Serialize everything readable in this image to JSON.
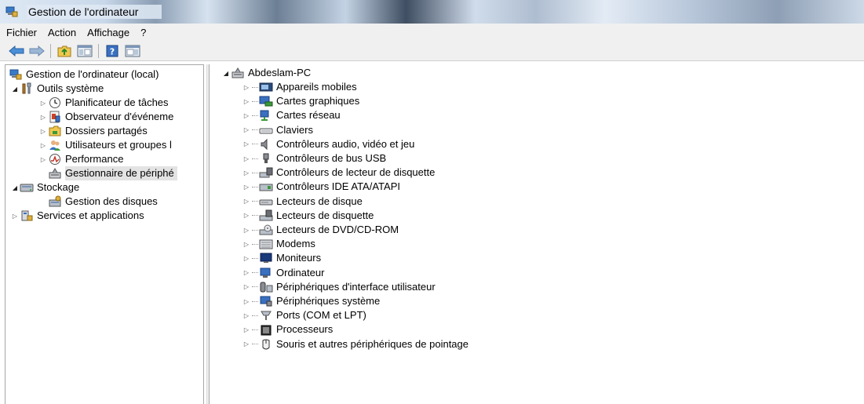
{
  "window": {
    "title": "Gestion de l'ordinateur"
  },
  "menu": [
    {
      "label": "Fichier"
    },
    {
      "label": "Action"
    },
    {
      "label": "Affichage"
    },
    {
      "label": "?"
    }
  ],
  "left_tree": [
    {
      "label": "Gestion de l'ordinateur (local)",
      "icon": "computer-management-icon",
      "expander": "none"
    },
    {
      "label": "Outils système",
      "icon": "system-tools-icon",
      "expander": "open"
    },
    {
      "label": "Planificateur de tâches",
      "icon": "task-scheduler-icon",
      "expander": "closed"
    },
    {
      "label": "Observateur d'événeme",
      "icon": "event-viewer-icon",
      "expander": "closed"
    },
    {
      "label": "Dossiers partagés",
      "icon": "shared-folders-icon",
      "expander": "closed"
    },
    {
      "label": "Utilisateurs et groupes l",
      "icon": "users-groups-icon",
      "expander": "closed"
    },
    {
      "label": "Performance",
      "icon": "performance-icon",
      "expander": "closed"
    },
    {
      "label": "Gestionnaire de périphé",
      "icon": "device-manager-icon",
      "expander": "none",
      "selected": true
    },
    {
      "label": "Stockage",
      "icon": "storage-icon",
      "expander": "open"
    },
    {
      "label": "Gestion des disques",
      "icon": "disk-management-icon",
      "expander": "none"
    },
    {
      "label": "Services et applications",
      "icon": "services-apps-icon",
      "expander": "closed"
    }
  ],
  "device_tree": {
    "root": "Abdeslam-PC",
    "categories": [
      {
        "label": "Appareils mobiles",
        "icon": "mobile-devices-icon"
      },
      {
        "label": "Cartes graphiques",
        "icon": "display-adapter-icon"
      },
      {
        "label": "Cartes réseau",
        "icon": "network-adapter-icon"
      },
      {
        "label": "Claviers",
        "icon": "keyboard-icon"
      },
      {
        "label": "Contrôleurs audio, vidéo et jeu",
        "icon": "audio-icon"
      },
      {
        "label": "Contrôleurs de bus USB",
        "icon": "usb-icon"
      },
      {
        "label": "Contrôleurs de lecteur de disquette",
        "icon": "floppy-controller-icon"
      },
      {
        "label": "Contrôleurs IDE ATA/ATAPI",
        "icon": "ide-controller-icon"
      },
      {
        "label": "Lecteurs de disque",
        "icon": "disk-drive-icon"
      },
      {
        "label": "Lecteurs de disquette",
        "icon": "floppy-drive-icon"
      },
      {
        "label": "Lecteurs de DVD/CD-ROM",
        "icon": "dvd-drive-icon"
      },
      {
        "label": "Modems",
        "icon": "modem-icon"
      },
      {
        "label": "Moniteurs",
        "icon": "monitor-icon"
      },
      {
        "label": "Ordinateur",
        "icon": "computer-icon"
      },
      {
        "label": "Périphériques d'interface utilisateur",
        "icon": "hid-icon"
      },
      {
        "label": "Périphériques système",
        "icon": "system-devices-icon"
      },
      {
        "label": "Ports (COM et LPT)",
        "icon": "ports-icon"
      },
      {
        "label": "Processeurs",
        "icon": "processor-icon"
      },
      {
        "label": "Souris et autres périphériques de pointage",
        "icon": "mouse-icon"
      }
    ]
  }
}
